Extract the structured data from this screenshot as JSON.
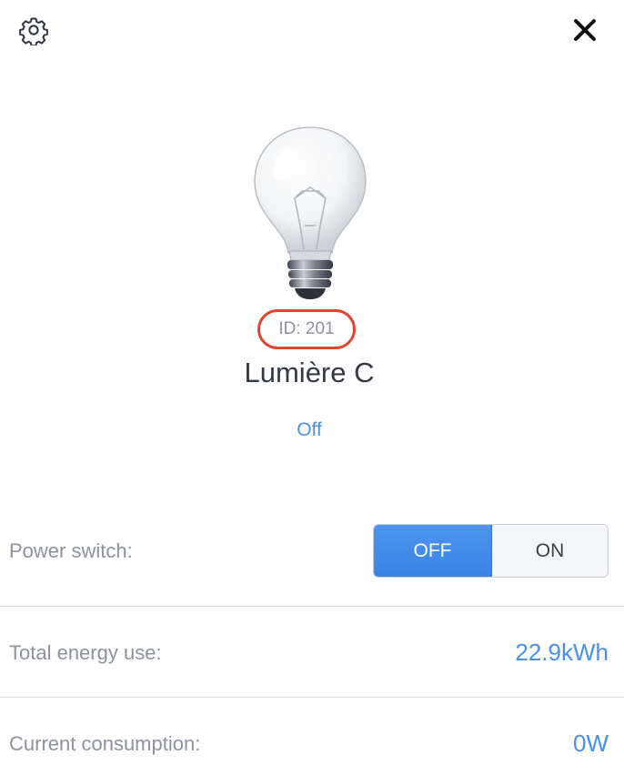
{
  "header": {
    "settings_icon": "gear-icon",
    "close_icon": "close-icon"
  },
  "device": {
    "image_icon": "lightbulb-icon",
    "id_label": "ID: 201",
    "name": "Lumière C",
    "status": "Off"
  },
  "power_switch": {
    "label": "Power switch:",
    "off_label": "OFF",
    "on_label": "ON",
    "selected": "OFF"
  },
  "energy": {
    "label": "Total energy use:",
    "value": "22.9kWh"
  },
  "consumption": {
    "label": "Current consumption:",
    "value": "0W"
  },
  "colors": {
    "accent": "#4a8fe8",
    "highlight_ring": "#e2432f",
    "label_text": "#8d929c"
  }
}
